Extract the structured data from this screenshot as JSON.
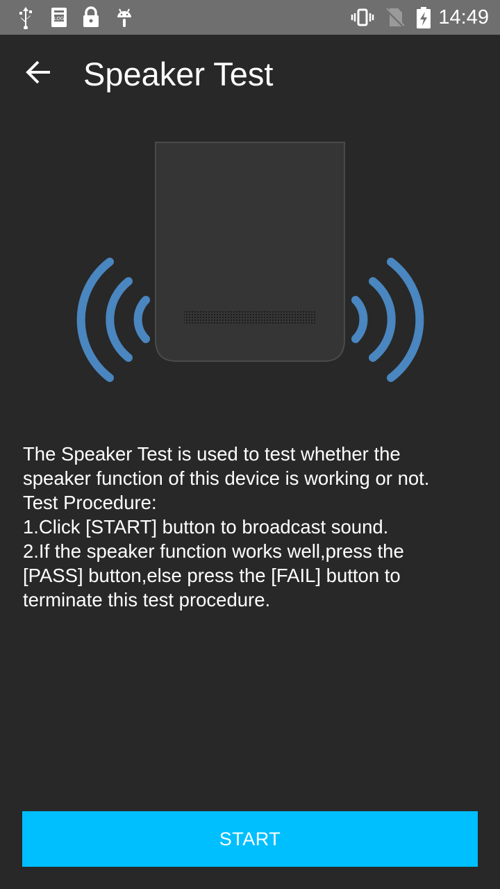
{
  "status_bar": {
    "time": "14:49",
    "left_icons": [
      "usb-icon",
      "log-icon",
      "lock-icon",
      "android-icon"
    ],
    "right_icons": [
      "vibrate-icon",
      "no-sim-icon",
      "battery-charging-icon"
    ]
  },
  "header": {
    "back_icon": "arrow-back-icon",
    "title": "Speaker Test"
  },
  "illustration": {
    "icon": "phone-speaker-icon",
    "wave_color": "#4a86c0"
  },
  "description": {
    "lines": [
      "The Speaker Test is used to test whether the",
      "speaker function of this device is working or not.",
      "Test Procedure:",
      "1.Click [START] button to broadcast sound.",
      "2.If the speaker function works well,press the",
      "[PASS] button,else press the [FAIL] button to",
      "terminate this test procedure."
    ]
  },
  "actions": {
    "start_label": "START",
    "start_color": "#00bfff"
  }
}
